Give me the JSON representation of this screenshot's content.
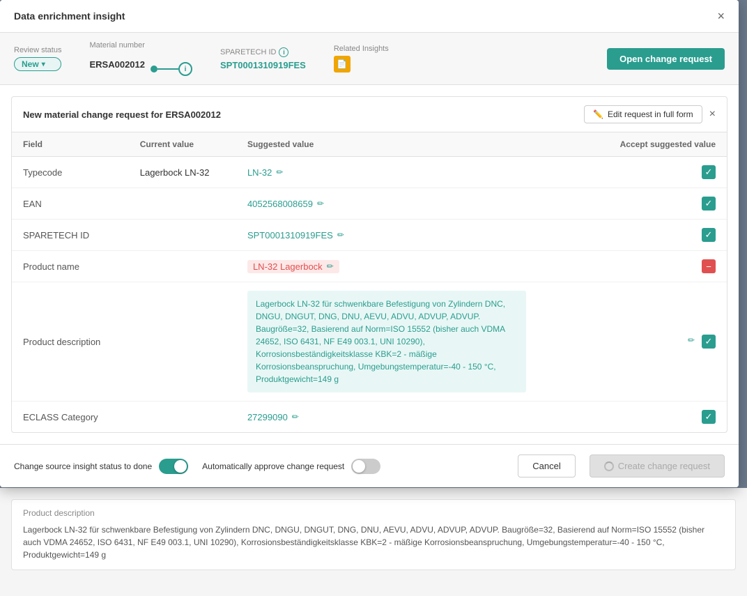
{
  "modal": {
    "title": "Data enrichment insight",
    "close_label": "×"
  },
  "status_bar": {
    "review_status_label": "Review status",
    "review_status_value": "New",
    "material_number_label": "Material number",
    "material_number_value": "ERSA002012",
    "sparetech_id_label": "SPARETECH ID",
    "sparetech_id_value": "SPT0001310919FES",
    "related_insights_label": "Related Insights",
    "related_insights_icon": "📄",
    "open_change_request_label": "Open change request"
  },
  "inner_panel": {
    "title": "New material change request for ERSA002012",
    "edit_label": "Edit request in full form",
    "close_label": "×"
  },
  "table": {
    "headers": {
      "field": "Field",
      "current_value": "Current value",
      "suggested_value": "Suggested value",
      "accept": "Accept suggested value"
    },
    "rows": [
      {
        "field": "Typecode",
        "current_value": "Lagerbock LN-32",
        "suggested_value": "LN-32",
        "has_edit": true,
        "checkbox_type": "checked",
        "highlight": "none"
      },
      {
        "field": "EAN",
        "current_value": "",
        "suggested_value": "4052568008659",
        "has_edit": true,
        "checkbox_type": "checked",
        "highlight": "none"
      },
      {
        "field": "SPARETECH ID",
        "current_value": "",
        "suggested_value": "SPT0001310919FES",
        "has_edit": true,
        "checkbox_type": "checked",
        "highlight": "none"
      },
      {
        "field": "Product name",
        "current_value": "",
        "suggested_value": "LN-32 Lagerbock",
        "has_edit": true,
        "checkbox_type": "minus",
        "highlight": "red"
      },
      {
        "field": "Product description",
        "current_value": "",
        "suggested_value": "Lagerbock LN-32 für schwenkbare Befestigung von Zylindern DNC, DNGU, DNGUT, DNG, DNU, AEVU, ADVU, ADVUP, ADVUP. Baugröße=32, Basierend auf Norm=ISO 15552 (bisher auch VDMA 24652, ISO 6431, NF E49 003.1, UNI 10290), Korrosionsbeständigkeitsklasse KBK=2 - mäßige Korrosionsbeanspruchung, Umgebungstemperatur=-40 - 150 °C, Produktgewicht=149 g",
        "has_edit": true,
        "checkbox_type": "checked",
        "highlight": "green"
      },
      {
        "field": "ECLASS Category",
        "current_value": "",
        "suggested_value": "27299090",
        "has_edit": true,
        "checkbox_type": "checked",
        "highlight": "none"
      }
    ]
  },
  "footer": {
    "toggle1_label": "Change source insight status to done",
    "toggle1_on": true,
    "toggle2_label": "Automatically approve change request",
    "toggle2_on": false,
    "cancel_label": "Cancel",
    "create_label": "Create change request"
  },
  "bg_panel": {
    "field_label": "Product description",
    "field_text": "Lagerbock LN-32 für schwenkbare Befestigung von Zylindern DNC, DNGU, DNGUT, DNG, DNU, AEVU, ADVU, ADVUP, ADVUP. Baugröße=32, Basierend auf Norm=ISO 15552 (bisher auch VDMA 24652, ISO 6431, NF E49 003.1, UNI 10290), Korrosionsbeständigkeitsklasse KBK=2 - mäßige Korrosionsbeanspruchung, Umgebungstemperatur=-40 - 150 °C, Produktgewicht=149 g"
  }
}
